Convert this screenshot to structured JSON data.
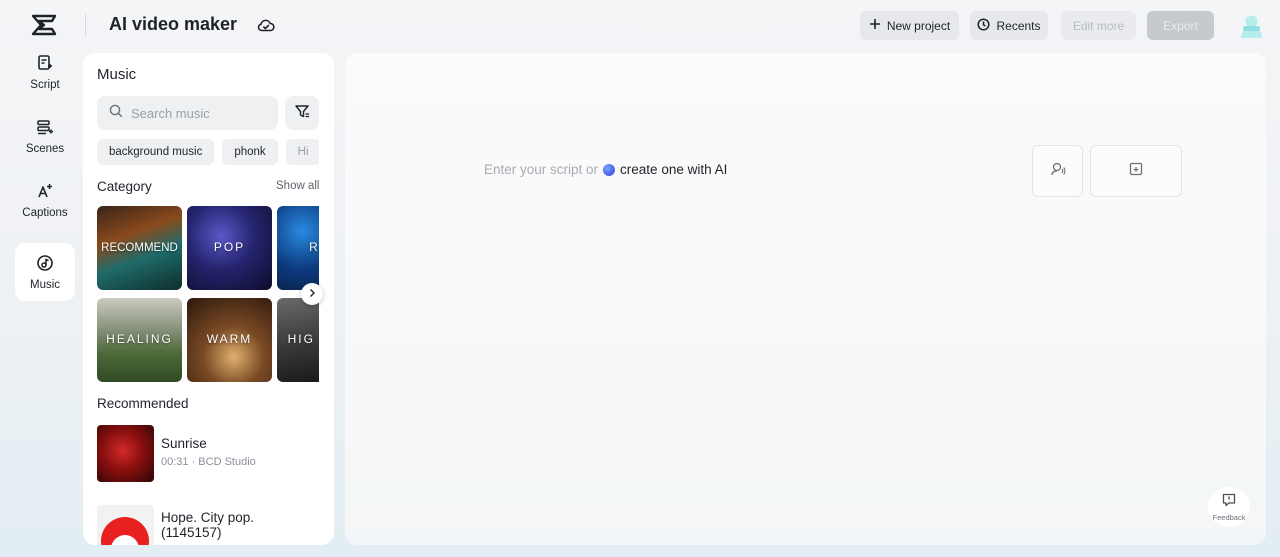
{
  "header": {
    "app_title": "AI video maker",
    "new_project_label": "New project",
    "recents_label": "Recents",
    "edit_more_label": "Edit more",
    "export_label": "Export"
  },
  "rail": {
    "items": [
      {
        "label": "Script",
        "icon": "script-icon"
      },
      {
        "label": "Scenes",
        "icon": "scenes-icon"
      },
      {
        "label": "Captions",
        "icon": "captions-icon"
      },
      {
        "label": "Music",
        "icon": "music-icon",
        "active": true
      }
    ]
  },
  "music_panel": {
    "title": "Music",
    "search_placeholder": "Search music",
    "tags": [
      "background music",
      "phonk",
      "Hi"
    ],
    "category_label": "Category",
    "show_all_label": "Show all",
    "categories": [
      {
        "label": "RECOMMEND"
      },
      {
        "label": "POP"
      },
      {
        "label": "R&"
      },
      {
        "label": "HEALING"
      },
      {
        "label": "WARM"
      },
      {
        "label": "HIG TEM"
      }
    ],
    "recommended_label": "Recommended",
    "tracks": [
      {
        "title": "Sunrise",
        "meta": "00:31 · BCD Studio"
      },
      {
        "title": "Hope. City pop. (1145157)",
        "meta": ""
      }
    ]
  },
  "canvas": {
    "prompt_placeholder": "Enter your script or",
    "prompt_link": "create one with AI"
  },
  "feedback_label": "Feedback"
}
